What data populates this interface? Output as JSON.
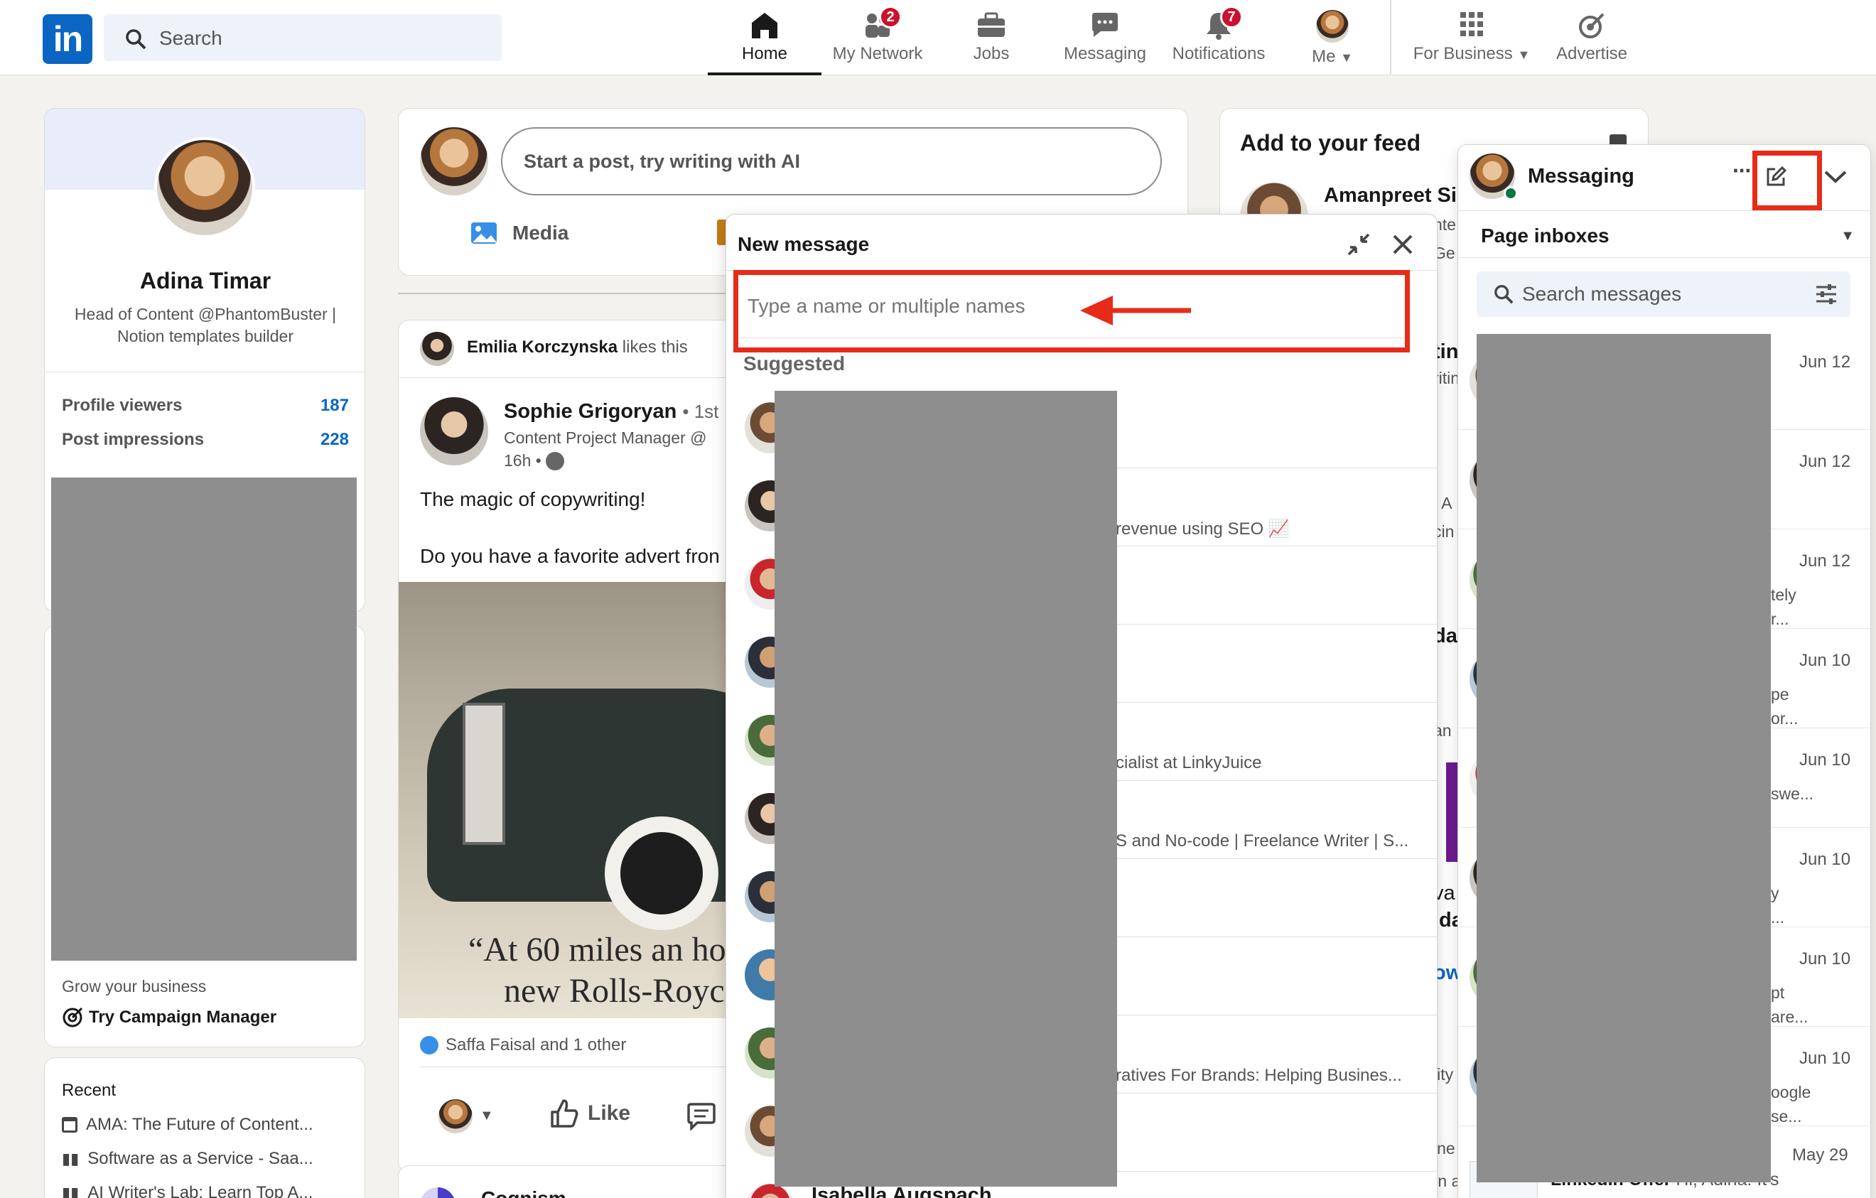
{
  "topnav": {
    "logo": "in",
    "search_placeholder": "Search",
    "items": [
      {
        "label": "Home",
        "icon": "home-icon"
      },
      {
        "label": "My Network",
        "icon": "network-icon",
        "badge": "2"
      },
      {
        "label": "Jobs",
        "icon": "jobs-icon"
      },
      {
        "label": "Messaging",
        "icon": "messaging-icon"
      },
      {
        "label": "Notifications",
        "icon": "bell-icon",
        "badge": "7"
      },
      {
        "label": "Me",
        "icon": "avatar"
      },
      {
        "label": "For Business",
        "icon": "grid-icon"
      },
      {
        "label": "Advertise",
        "icon": "advertise-icon"
      }
    ]
  },
  "profile": {
    "name": "Adina Timar",
    "headline": "Head of Content @PhantomBuster | Notion templates builder",
    "stats": [
      {
        "label": "Profile viewers",
        "value": "187"
      },
      {
        "label": "Post impressions",
        "value": "228"
      }
    ],
    "grow_label": "Grow your business",
    "campaign_link": "Try Campaign Manager",
    "recent_label": "Recent",
    "recent_items": [
      "AMA: The Future of Content...",
      "Software as a Service - Saa...",
      "AI Writer's Lab: Learn Top A..."
    ]
  },
  "composer": {
    "placeholder": "Start a post, try writing with AI",
    "media_label": "Media"
  },
  "post": {
    "activity_actor": "Emilia Korczynska",
    "activity_text": "likes this",
    "author": "Sophie Grigoryan",
    "degree": "• 1st",
    "author_title": "Content Project Manager @",
    "time": "16h •",
    "text1": "The magic of copywriting!",
    "text2": "Do you have a favorite advert fron",
    "ad_line1": "“At 60 miles an ho",
    "ad_line2": "new Rolls-Royce co",
    "reactions": "Saffa Faisal and 1 other",
    "like_label": "Like",
    "next_author": "Cognism"
  },
  "feed_card": {
    "title": "Add to your feed",
    "person": "Amanpreet Sin",
    "fragments": [
      "nte",
      "Ge",
      "tin",
      "ritin",
      "| A",
      "cin",
      "dat",
      "an",
      "va",
      "ida",
      "ow",
      "lity",
      "ine",
      "In a"
    ]
  },
  "new_message": {
    "title": "New message",
    "to_placeholder": "Type a name or multiple names",
    "suggested_label": "Suggested",
    "rows": [
      {
        "snippet": ""
      },
      {
        "snippet": "revenue using SEO 📈"
      },
      {
        "snippet": ""
      },
      {
        "snippet": ""
      },
      {
        "snippet": "cialist at LinkyJuice"
      },
      {
        "snippet": "S and No-code | Freelance Writer | S..."
      },
      {
        "snippet": ""
      },
      {
        "snippet": ""
      },
      {
        "snippet": "ratives For Brands: Helping Busines..."
      },
      {
        "snippet": ""
      }
    ],
    "last_name": "Isabella Augspach"
  },
  "messaging": {
    "title": "Messaging",
    "inbox_label": "Page inboxes",
    "search_placeholder": "Search messages",
    "threads": [
      {
        "date": "Jun 12",
        "snippet": ""
      },
      {
        "date": "Jun 12",
        "snippet": ""
      },
      {
        "date": "Jun 12",
        "snippet": "tely\nr..."
      },
      {
        "date": "Jun 10",
        "snippet": "pe\nor..."
      },
      {
        "date": "Jun 10",
        "snippet": "swe..."
      },
      {
        "date": "Jun 10",
        "snippet": "y\n..."
      },
      {
        "date": "Jun 10",
        "snippet": "pt\nare..."
      },
      {
        "date": "Jun 10",
        "snippet": "oogle\nse..."
      },
      {
        "date": "May 29",
        "snippet": "Hi, Adina! It's"
      }
    ],
    "last_sender": "LinkedIn Offer"
  },
  "colors": {
    "brand": "#0a66c2",
    "highlight": "#e62c18",
    "badge": "#cb112d"
  }
}
